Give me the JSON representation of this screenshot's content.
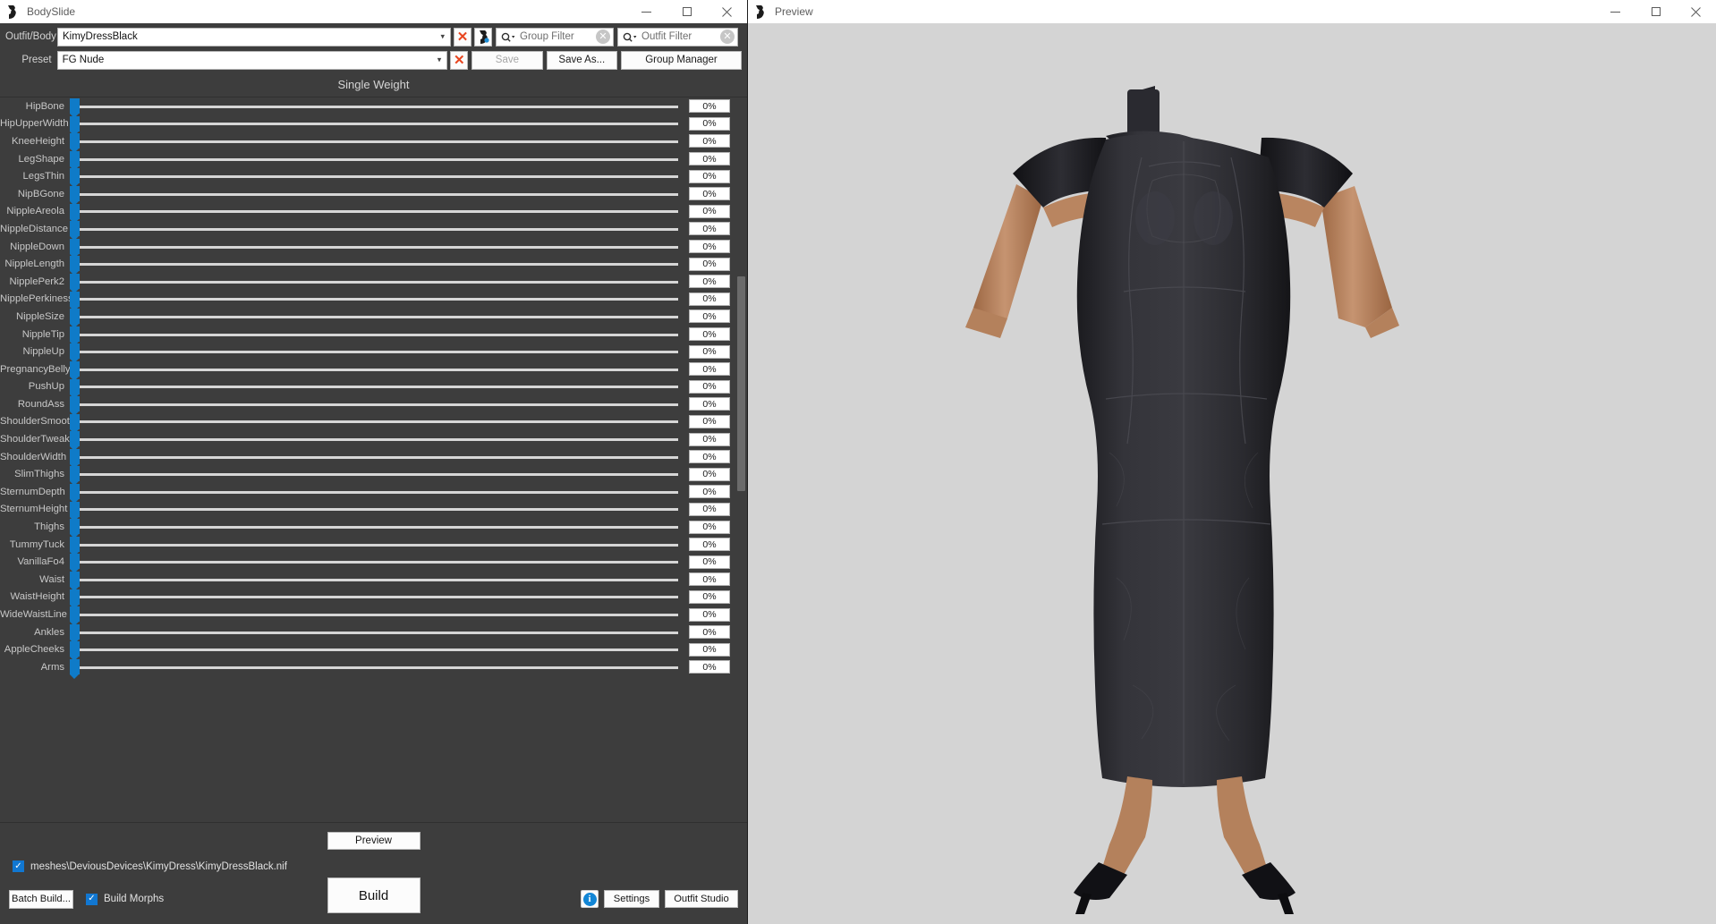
{
  "main_window": {
    "title": "BodySlide",
    "icon": "bodyslide-icon",
    "window_controls": {
      "minimize": "—",
      "maximize": "☐",
      "close": "✕"
    }
  },
  "preview_window": {
    "title": "Preview",
    "icon": "bodyslide-icon",
    "window_controls": {
      "minimize": "—",
      "maximize": "☐",
      "close": "✕"
    }
  },
  "toolbar": {
    "outfit_label": "Outfit/Body",
    "outfit_value": "KimyDressBlack",
    "outfit_clear_icon": "x-icon",
    "outfit_choose_icon": "bodyslide-icon",
    "preset_label": "Preset",
    "preset_value": "FG Nude",
    "preset_clear_icon": "x-icon",
    "group_filter_placeholder": "Group Filter",
    "outfit_filter_placeholder": "Outfit Filter",
    "group_filter_value": "",
    "outfit_filter_value": "",
    "search_icon": "search-icon",
    "clear_icon": "clear-circle-icon",
    "save_label": "Save",
    "save_as_label": "Save As...",
    "group_manager_label": "Group Manager"
  },
  "weight_header": "Single Weight",
  "sliders": [
    {
      "name": "HipBone",
      "value": "0%"
    },
    {
      "name": "HipUpperWidth",
      "value": "0%"
    },
    {
      "name": "KneeHeight",
      "value": "0%"
    },
    {
      "name": "LegShape",
      "value": "0%"
    },
    {
      "name": "LegsThin",
      "value": "0%"
    },
    {
      "name": "NipBGone",
      "value": "0%"
    },
    {
      "name": "NippleAreola",
      "value": "0%"
    },
    {
      "name": "NippleDistance",
      "value": "0%"
    },
    {
      "name": "NippleDown",
      "value": "0%"
    },
    {
      "name": "NippleLength",
      "value": "0%"
    },
    {
      "name": "NipplePerk2",
      "value": "0%"
    },
    {
      "name": "NipplePerkiness",
      "value": "0%"
    },
    {
      "name": "NippleSize",
      "value": "0%"
    },
    {
      "name": "NippleTip",
      "value": "0%"
    },
    {
      "name": "NippleUp",
      "value": "0%"
    },
    {
      "name": "PregnancyBelly",
      "value": "0%"
    },
    {
      "name": "PushUp",
      "value": "0%"
    },
    {
      "name": "RoundAss",
      "value": "0%"
    },
    {
      "name": "ShoulderSmooth",
      "value": "0%"
    },
    {
      "name": "ShoulderTweak",
      "value": "0%"
    },
    {
      "name": "ShoulderWidth",
      "value": "0%"
    },
    {
      "name": "SlimThighs",
      "value": "0%"
    },
    {
      "name": "SternumDepth",
      "value": "0%"
    },
    {
      "name": "SternumHeight",
      "value": "0%"
    },
    {
      "name": "Thighs",
      "value": "0%"
    },
    {
      "name": "TummyTuck",
      "value": "0%"
    },
    {
      "name": "VanillaFo4",
      "value": "0%"
    },
    {
      "name": "Waist",
      "value": "0%"
    },
    {
      "name": "WaistHeight",
      "value": "0%"
    },
    {
      "name": "WideWaistLine",
      "value": "0%"
    },
    {
      "name": "Ankles",
      "value": "0%"
    },
    {
      "name": "AppleCheeks",
      "value": "0%"
    },
    {
      "name": "Arms",
      "value": "0%"
    }
  ],
  "footer": {
    "preview_label": "Preview",
    "mesh_file": "meshes\\DeviousDevices\\KimyDress\\KimyDressBlack.nif",
    "mesh_file_checked": true,
    "batch_build_label": "Batch Build...",
    "build_morphs_label": "Build Morphs",
    "build_morphs_checked": true,
    "build_label": "Build",
    "info_icon": "info-icon",
    "settings_label": "Settings",
    "outfit_studio_label": "Outfit Studio",
    "check_glyph": "✓"
  },
  "colors": {
    "accent_blue": "#0f7bc8",
    "checkbox_blue": "#1177d1",
    "clear_red": "#e8451f",
    "panel_bg": "#3d3d3d",
    "preview_bg": "#d4d4d4",
    "skin": "#c08a63",
    "dress": "#26262a"
  }
}
